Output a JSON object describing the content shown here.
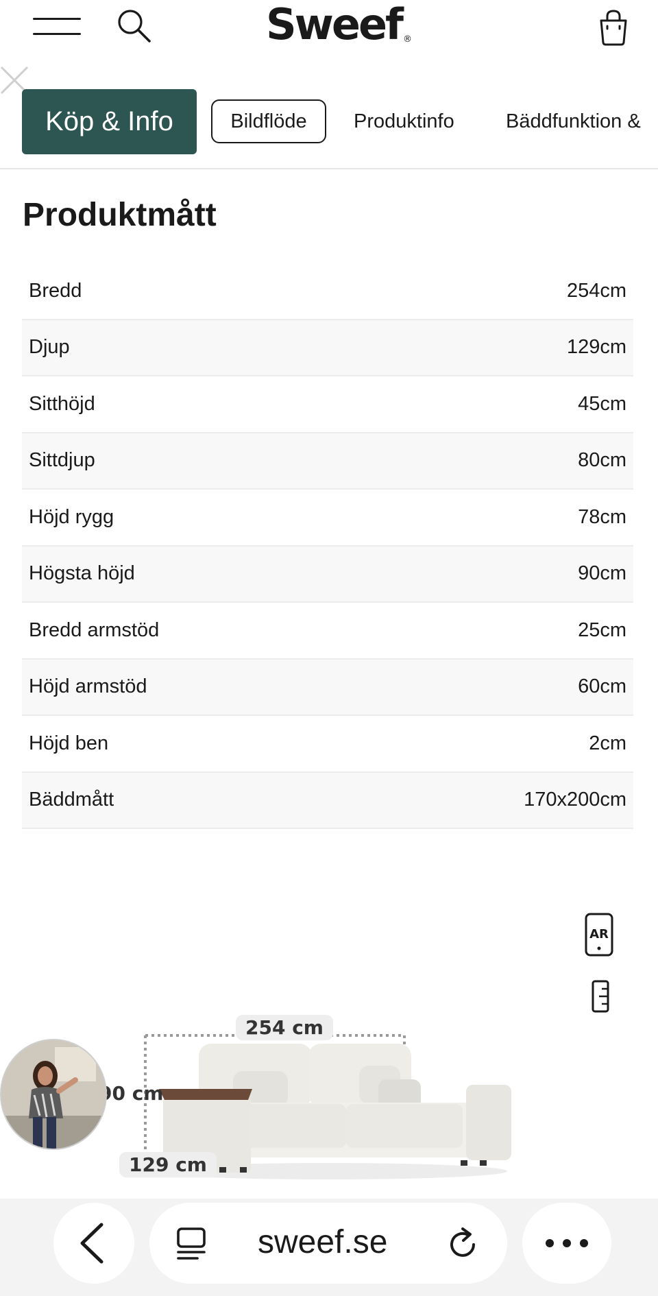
{
  "header": {
    "logo": "Sweef",
    "logo_mark": "®",
    "icons": {
      "menu": "hamburger-menu-icon",
      "search": "search-icon",
      "cart": "shopping-bag-icon"
    }
  },
  "tabs": [
    {
      "label": "Köp & Info",
      "active": true
    },
    {
      "label": "Bildflöde"
    },
    {
      "label": "Produktinfo"
    },
    {
      "label": "Bäddfunktion &"
    }
  ],
  "colors": {
    "accent": "#2d5652",
    "row_alt": "#f8f8f8"
  },
  "section": {
    "title": "Produktmått"
  },
  "specs": [
    {
      "label": "Bredd",
      "value": "254cm"
    },
    {
      "label": "Djup",
      "value": "129cm"
    },
    {
      "label": "Sitthöjd",
      "value": "45cm"
    },
    {
      "label": "Sittdjup",
      "value": "80cm"
    },
    {
      "label": "Höjd rygg",
      "value": "78cm"
    },
    {
      "label": "Högsta höjd",
      "value": "90cm"
    },
    {
      "label": "Bredd armstöd",
      "value": "25cm"
    },
    {
      "label": "Höjd armstöd",
      "value": "60cm"
    },
    {
      "label": "Höjd ben",
      "value": "2cm"
    },
    {
      "label": "Bäddmått",
      "value": "170x200cm"
    }
  ],
  "viewer": {
    "ar_label": "AR",
    "dims": {
      "width": "254 cm",
      "height": "90 cm",
      "depth": "129 cm"
    }
  },
  "browser": {
    "url": "sweef.se"
  }
}
